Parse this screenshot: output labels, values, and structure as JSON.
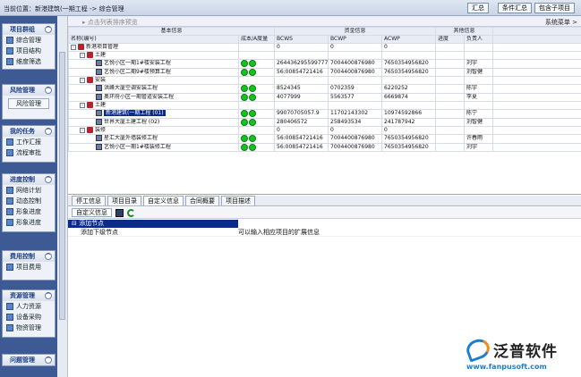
{
  "topbar": {
    "location": "当前位置：新港建筑(一期工程 -> 综合管理",
    "buttons": [
      "汇总",
      "条件汇总",
      "包含子项目"
    ]
  },
  "sidebar": {
    "groups": [
      {
        "title": "项目群组",
        "items": [
          "综合管理",
          "项目结构",
          "维度筛选"
        ]
      },
      {
        "title": "风险管理",
        "items": [
          "风险管理"
        ],
        "button_style": true
      },
      {
        "title": "我的任务",
        "items": [
          "工作汇报",
          "流程审批"
        ]
      },
      {
        "title": "进度控制",
        "items": [
          "网络计划",
          "动态控制",
          "形象进度",
          "形象进度"
        ]
      },
      {
        "title": "费用控制",
        "items": [
          "项目费用"
        ]
      },
      {
        "title": "资源管理",
        "items": [
          "人力资源",
          "设备采购",
          "物资管理"
        ]
      },
      {
        "title": "问题管理",
        "items": []
      }
    ]
  },
  "toolbar": {
    "hint": "▸ 点击列表排序预览",
    "right": "系统菜单 >"
  },
  "grid": {
    "group_headers": [
      "基本信息",
      "资金信息",
      "其他信息"
    ],
    "columns": [
      "名称(编号)",
      "成本/A度量",
      "BCWS",
      "BCWP",
      "ACWP",
      "进度",
      "负责人"
    ],
    "rows": [
      {
        "level": 0,
        "kind": "node",
        "name": "新港项目管理",
        "dots": 0,
        "bcws": "0",
        "bcwp": "0",
        "acwp": "0",
        "owner": ""
      },
      {
        "level": 1,
        "kind": "node",
        "name": "土建",
        "dots": 0,
        "bcws": "",
        "bcwp": "",
        "acwp": "",
        "owner": ""
      },
      {
        "level": 2,
        "kind": "doc",
        "name": "艺悦小区一期1#楼安装工程",
        "dots": 2,
        "bcws": "264436295599777",
        "bcwp": "7004400876980",
        "acwp": "7650354956820",
        "owner": "刘宇"
      },
      {
        "level": 2,
        "kind": "doc",
        "name": "艺悦小区二期9#楼预算工程",
        "dots": 2,
        "bcws": "56:00854721416",
        "bcwp": "7004400876980",
        "acwp": "7650354956820",
        "owner": "刘智健"
      },
      {
        "level": 1,
        "kind": "node",
        "name": "安装",
        "dots": 0,
        "bcws": "",
        "bcwp": "",
        "acwp": "",
        "owner": ""
      },
      {
        "level": 2,
        "kind": "doc",
        "name": "洪峰大厦空调安装工程",
        "dots": 2,
        "bcws": "8524345",
        "bcwp": "0702359",
        "acwp": "6220252",
        "owner": "陈宇"
      },
      {
        "level": 2,
        "kind": "doc",
        "name": "奥环府小区一期管道安装工程",
        "dots": 2,
        "bcws": "4077999",
        "bcwp": "5563577",
        "acwp": "6669874",
        "owner": "李夏"
      },
      {
        "level": 1,
        "kind": "node",
        "name": "土建",
        "dots": 0,
        "bcws": "",
        "bcwp": "",
        "acwp": "",
        "owner": ""
      },
      {
        "level": 2,
        "kind": "doc",
        "name": "新港建筑(一期工程 (01)",
        "dots": 2,
        "bcws": "99070705057.9",
        "bcwp": "11702143302",
        "acwp": "10974592866",
        "owner": "陈宁",
        "selected": true
      },
      {
        "level": 2,
        "kind": "doc",
        "name": "世界大厦土建工程 (02)",
        "dots": 2,
        "bcws": "280406572",
        "bcwp": "258493534",
        "acwp": "241787942",
        "owner": "刘智健"
      },
      {
        "level": 1,
        "kind": "node",
        "name": "装修",
        "dots": 0,
        "bcws": "0",
        "bcwp": "0",
        "acwp": "0",
        "owner": ""
      },
      {
        "level": 2,
        "kind": "doc",
        "name": "星汇大厦外墙装修工程",
        "dots": 2,
        "bcws": "56:00854721416",
        "bcwp": "7004400876980",
        "acwp": "7650354956820",
        "owner": "许春雨"
      },
      {
        "level": 2,
        "kind": "doc",
        "name": "艺悦小区一期1#楼装修工程",
        "dots": 2,
        "bcws": "56:00854721416",
        "bcwp": "7004400876980",
        "acwp": "7650354956820",
        "owner": "刘宇"
      }
    ]
  },
  "tabs": [
    "停工信息",
    "项目目录",
    "自定义信息",
    "合同概要",
    "项目描述"
  ],
  "active_tab": 2,
  "subbar": {
    "button": "自定义信息"
  },
  "props": {
    "category": "添加节点",
    "rows": [
      {
        "key": "添加下级节点",
        "value": "可以输入相应项目的扩展信息"
      }
    ]
  },
  "logo": {
    "name": "泛普软件",
    "url": "www.fanpusoft.com"
  }
}
